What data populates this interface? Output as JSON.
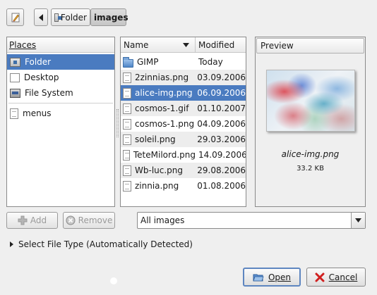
{
  "toolbar": {
    "edit_icon": "pencil-icon",
    "back_icon": "triangle-left-icon",
    "breadcrumbs": [
      {
        "label": "Folder",
        "icon": "home-folder-icon",
        "active": false
      },
      {
        "label": "images",
        "active": true
      }
    ]
  },
  "places": {
    "header": "Places",
    "items": [
      {
        "label": "Folder",
        "icon": "home-folder-icon",
        "selected": true
      },
      {
        "label": "Desktop",
        "icon": "desktop-icon",
        "selected": false
      },
      {
        "label": "File System",
        "icon": "harddisk-icon",
        "selected": false
      }
    ],
    "bookmarks": [
      {
        "label": "menus",
        "icon": "file-icon"
      }
    ]
  },
  "files": {
    "col_name": "Name",
    "col_modified": "Modified",
    "rows": [
      {
        "name": "GIMP",
        "modified": "Today",
        "type": "folder"
      },
      {
        "name": "2zinnias.png",
        "modified": "03.09.2006",
        "type": "file"
      },
      {
        "name": "alice-img.png",
        "modified": "06.09.2006",
        "type": "file",
        "selected": true
      },
      {
        "name": "cosmos-1.gif",
        "modified": "01.10.2007",
        "type": "file"
      },
      {
        "name": "cosmos-1.png",
        "modified": "04.09.2006",
        "type": "file"
      },
      {
        "name": "soleil.png",
        "modified": "29.03.2006",
        "type": "file"
      },
      {
        "name": "TeteMilord.png",
        "modified": "14.09.2006",
        "type": "file"
      },
      {
        "name": "Wb-luc.png",
        "modified": "29.08.2006",
        "type": "file"
      },
      {
        "name": "zinnia.png",
        "modified": "01.08.2006",
        "type": "file"
      }
    ]
  },
  "preview": {
    "header": "Preview",
    "filename": "alice-img.png",
    "size": "33.2 KB"
  },
  "actions": {
    "add_label": "Add",
    "remove_label": "Remove"
  },
  "filter": {
    "selected": "All images"
  },
  "file_type": {
    "label": "Select File Type (Automatically Detected)"
  },
  "buttons": {
    "open_label": "Open",
    "cancel_label": "Cancel"
  },
  "colors": {
    "selection": "#4a7bc0",
    "background": "#efefef"
  }
}
